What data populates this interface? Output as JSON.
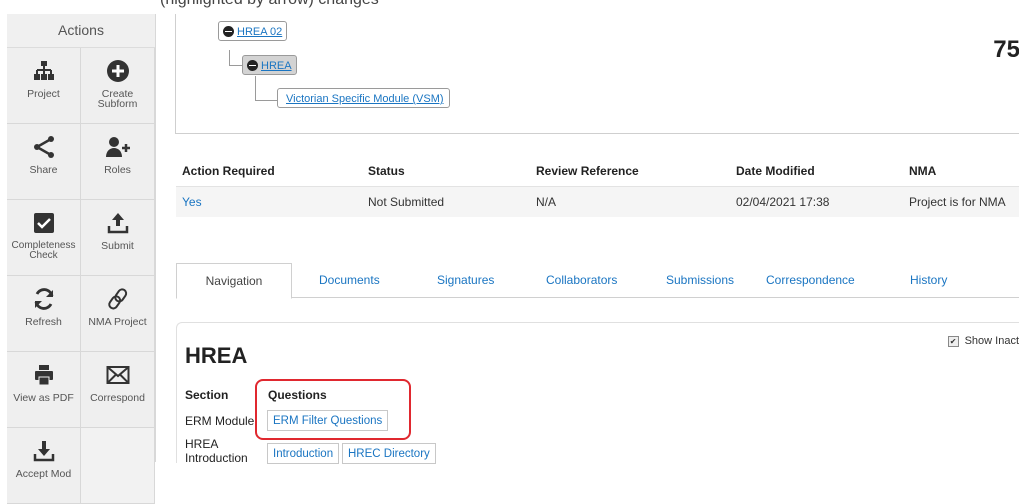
{
  "top_partial_text": "(highlighted by arrow) changes",
  "sidebar": {
    "header": "Actions",
    "tiles": [
      {
        "label": "Project",
        "icon": "org-chart-icon"
      },
      {
        "label": "Create Subform",
        "icon": "plus-circle-icon"
      },
      {
        "label": "Share",
        "icon": "share-icon"
      },
      {
        "label": "Roles",
        "icon": "add-user-icon"
      },
      {
        "label": "Completeness Check",
        "icon": "checkbox-icon"
      },
      {
        "label": "Submit",
        "icon": "upload-icon"
      },
      {
        "label": "Refresh",
        "icon": "refresh-icon"
      },
      {
        "label": "NMA Project",
        "icon": "link-icon"
      },
      {
        "label": "View as PDF",
        "icon": "printer-icon"
      },
      {
        "label": "Correspond",
        "icon": "envelope-icon"
      },
      {
        "label": "Accept Mod",
        "icon": "download-icon"
      }
    ]
  },
  "tree": {
    "nodes": [
      {
        "label": "HREA 02"
      },
      {
        "label": "HREA"
      },
      {
        "label": "Victorian Specific Module (VSM)"
      }
    ],
    "partial_number": "75"
  },
  "info_table": {
    "headers": [
      "Action Required",
      "Status",
      "Review Reference",
      "Date Modified",
      "NMA"
    ],
    "row": [
      "Yes",
      "Not Submitted",
      "N/A",
      "02/04/2021 17:38",
      "Project is for NMA"
    ]
  },
  "tabs": [
    "Navigation",
    "Documents",
    "Signatures",
    "Collaborators",
    "Submissions",
    "Correspondence",
    "History"
  ],
  "panel": {
    "show_inactive": "Show Inact",
    "title": "HREA",
    "section_header": "Section",
    "questions_header": "Questions",
    "rows": [
      {
        "section": "ERM Module",
        "buttons": [
          "ERM Filter Questions"
        ]
      },
      {
        "section": "HREA Introduction",
        "buttons": [
          "Introduction",
          "HREC Directory"
        ]
      }
    ]
  },
  "colors": {
    "link": "#1a75c2",
    "highlight": "#e0282f"
  }
}
